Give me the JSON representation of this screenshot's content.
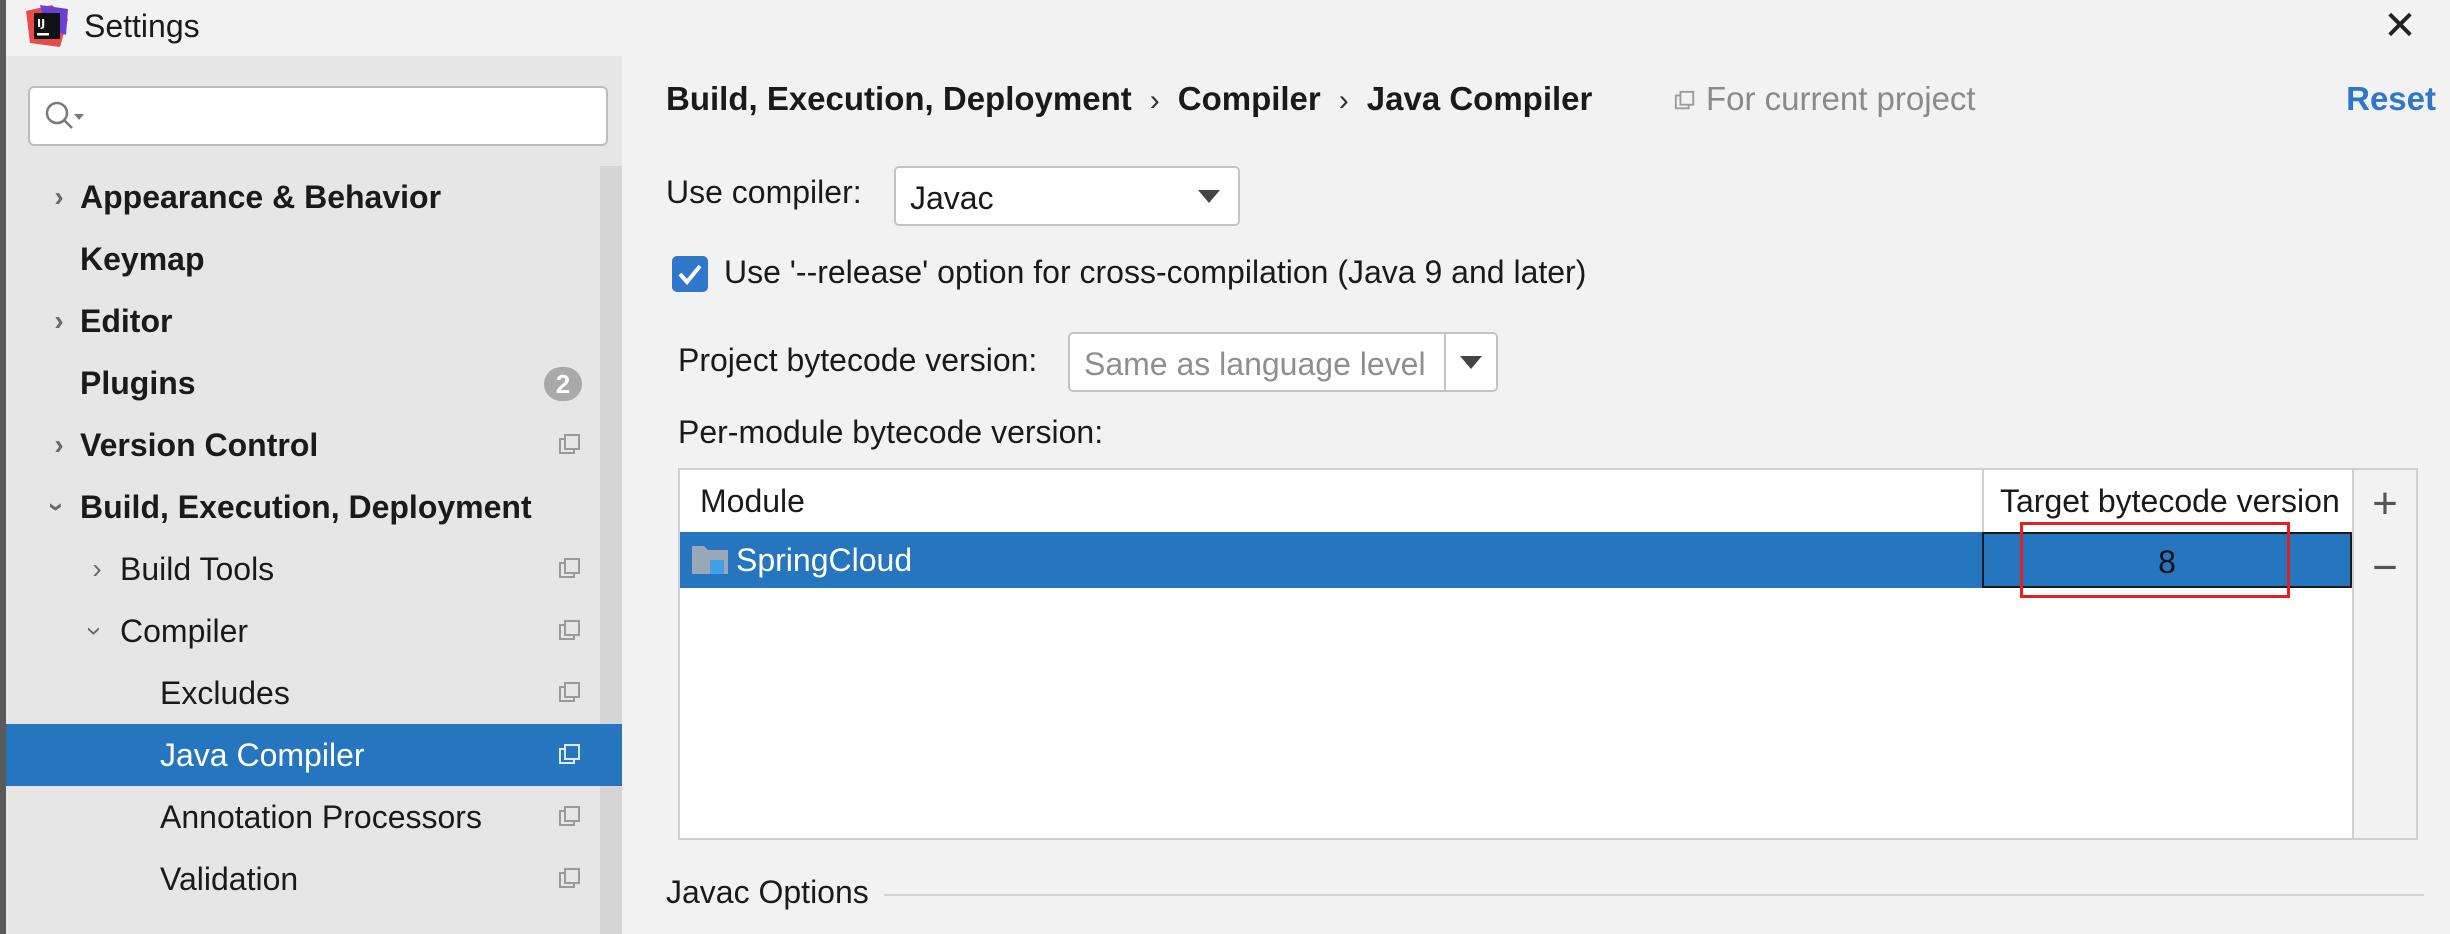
{
  "window": {
    "title": "Settings",
    "close_icon": "close-icon"
  },
  "sidebar": {
    "search_placeholder": "",
    "items": [
      {
        "label": "Appearance & Behavior",
        "expandable": true,
        "expanded": false
      },
      {
        "label": "Keymap",
        "expandable": false
      },
      {
        "label": "Editor",
        "expandable": true,
        "expanded": false
      },
      {
        "label": "Plugins",
        "expandable": false,
        "badge": "2"
      },
      {
        "label": "Version Control",
        "expandable": true,
        "expanded": false
      },
      {
        "label": "Build, Execution, Deployment",
        "expandable": true,
        "expanded": true
      },
      {
        "label": "Build Tools",
        "expandable": true,
        "expanded": false
      },
      {
        "label": "Compiler",
        "expandable": true,
        "expanded": true
      },
      {
        "label": "Excludes"
      },
      {
        "label": "Java Compiler",
        "selected": true
      },
      {
        "label": "Annotation Processors"
      },
      {
        "label": "Validation"
      }
    ]
  },
  "header": {
    "breadcrumb": [
      "Build, Execution, Deployment",
      "Compiler",
      "Java Compiler"
    ],
    "separator": "›",
    "scope_label": "For current project",
    "reset_label": "Reset"
  },
  "form": {
    "use_compiler_label": "Use compiler:",
    "use_compiler_value": "Javac",
    "release_option_label": "Use '--release' option for cross-compilation (Java 9 and later)",
    "release_option_checked": true,
    "project_bytecode_label": "Project bytecode version:",
    "project_bytecode_value": "Same as language level",
    "per_module_label": "Per-module bytecode version:"
  },
  "module_table": {
    "columns": [
      "Module",
      "Target bytecode version"
    ],
    "rows": [
      {
        "module": "SpringCloud",
        "target": "8"
      }
    ],
    "add_button": "+",
    "remove_button": "−"
  },
  "javac_options": {
    "title": "Javac Options"
  },
  "colors": {
    "selection": "#2675bf",
    "link": "#2e77c9",
    "highlight_box": "#e02020"
  }
}
